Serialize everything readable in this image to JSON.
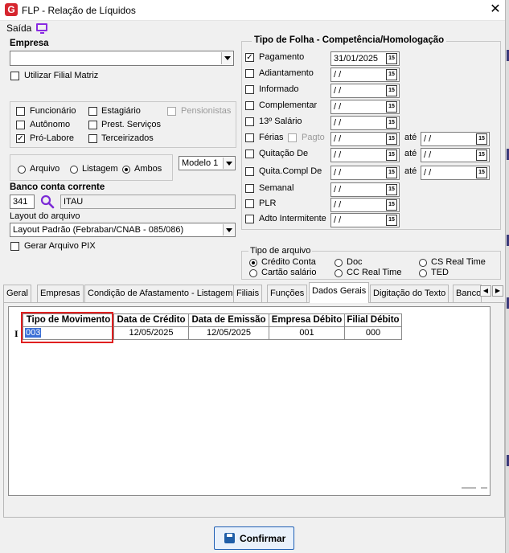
{
  "window": {
    "title": "FLP - Relação de Líquidos",
    "close_glyph": "✕",
    "logo_letter": "G"
  },
  "menu": {
    "saida": "Saída"
  },
  "left": {
    "empresa_label": "Empresa",
    "empresa_value": "",
    "utilizar_filial_label": "Utilizar Filial Matriz",
    "categorias": {
      "funcionario": "Funcionário",
      "estagiario": "Estagiário",
      "pensionistas": "Pensionistas",
      "autonomo": "Autônomo",
      "prest_servicos": "Prest. Serviços",
      "pro_labore": "Pró-Labore",
      "terceirizados": "Terceirizados"
    },
    "saida_tipo": {
      "arquivo": "Arquivo",
      "listagem": "Listagem",
      "ambos": "Ambos",
      "selected": "Ambos"
    },
    "modelo_value": "Modelo 1",
    "banco_label": "Banco conta corrente",
    "banco_codigo": "341",
    "banco_nome": "ITAU",
    "layout_label": "Layout do arquivo",
    "layout_value": "Layout Padrão (Febraban/CNAB - 085/086)",
    "gerar_pix_label": "Gerar Arquivo PIX"
  },
  "tipo_folha": {
    "title": "Tipo de Folha  -  Competência/Homologação",
    "calendar_glyph": "15",
    "ate": "até",
    "empty_date": " / /",
    "rows": [
      {
        "label": "Pagamento",
        "checked": true,
        "date": "31/01/2025"
      },
      {
        "label": "Adiantamento",
        "checked": false,
        "date": " / /"
      },
      {
        "label": "Informado",
        "checked": false,
        "date": " / /"
      },
      {
        "label": "Complementar",
        "checked": false,
        "date": " / /"
      },
      {
        "label": "13º Salário",
        "checked": false,
        "date": " / /"
      },
      {
        "label": "Férias",
        "checked": false,
        "date": " / /"
      },
      {
        "label": "Quitação De",
        "checked": false,
        "date": " / /"
      },
      {
        "label": "Quita.Compl De",
        "checked": false,
        "date": " / /"
      },
      {
        "label": "Semanal",
        "checked": false,
        "date": " / /"
      },
      {
        "label": "PLR",
        "checked": false,
        "date": " / /"
      },
      {
        "label": "Adto Intermitente",
        "checked": false,
        "date": " / /"
      }
    ],
    "pagto_label": "Pagto"
  },
  "tipo_arquivo": {
    "title": "Tipo de arquivo",
    "options": [
      "Crédito Conta",
      "Cartão salário",
      "Doc",
      "CC Real Time",
      "CS Real Time",
      "TED"
    ],
    "selected": "Crédito Conta"
  },
  "tabs": [
    "Geral",
    "Empresas",
    "Condição de Afastamento - Listagem",
    "Filiais",
    "Funções",
    "Dados Gerais",
    "Digitação do Texto",
    "Banco"
  ],
  "active_tab": "Dados Gerais",
  "grid": {
    "row_indicator": "I",
    "columns": [
      "Tipo de Movimento",
      "Data de Crédito",
      "Data de Emissão",
      "Empresa Débito",
      "Filial Débito"
    ],
    "rows": [
      [
        "003",
        "12/05/2025",
        "12/05/2025",
        "001",
        "000"
      ]
    ]
  },
  "footer": {
    "confirm_label": "Confirmar"
  },
  "colors": {
    "highlight_border": "#e02020",
    "selection_bg": "#3b6fd6",
    "accent_purple": "#8a2be2",
    "logo_red": "#d6262f"
  }
}
